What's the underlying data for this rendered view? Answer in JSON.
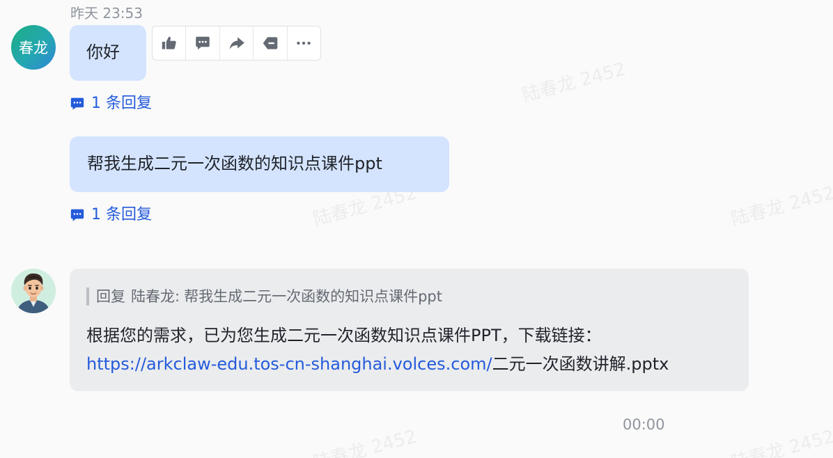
{
  "watermark": {
    "text": "陆春龙 2452"
  },
  "messages": [
    {
      "timestamp": "昨天 23:53",
      "sender_avatar_text": "春龙",
      "text": "你好",
      "reply_count_label": "1 条回复"
    },
    {
      "text": "帮我生成二元一次函数的知识点课件ppt",
      "reply_count_label": "1 条回复"
    }
  ],
  "toolbar": {
    "actions": [
      {
        "icon": "thumbs-up-icon",
        "name": "like"
      },
      {
        "icon": "comment-icon",
        "name": "reply"
      },
      {
        "icon": "forward-icon",
        "name": "forward"
      },
      {
        "icon": "delete-icon",
        "name": "recall"
      },
      {
        "icon": "more-icon",
        "name": "more"
      }
    ]
  },
  "bot_reply": {
    "quote_label": "回复",
    "quote_author": "陆春龙:",
    "quote_text": "帮我生成二元一次函数的知识点课件ppt",
    "line1": "根据您的需求，已为您生成二元一次函数知识点课件PPT，下载链接：",
    "link_text": "https://arkclaw-edu.tos-cn-shanghai.volces.com/",
    "link_suffix": "二元一次函数讲解.pptx",
    "time": "00:00"
  },
  "colors": {
    "accent": "#245bdb",
    "user_bubble": "#d4e4ff",
    "bot_card": "#ebecee",
    "muted_text": "#8f959e"
  }
}
